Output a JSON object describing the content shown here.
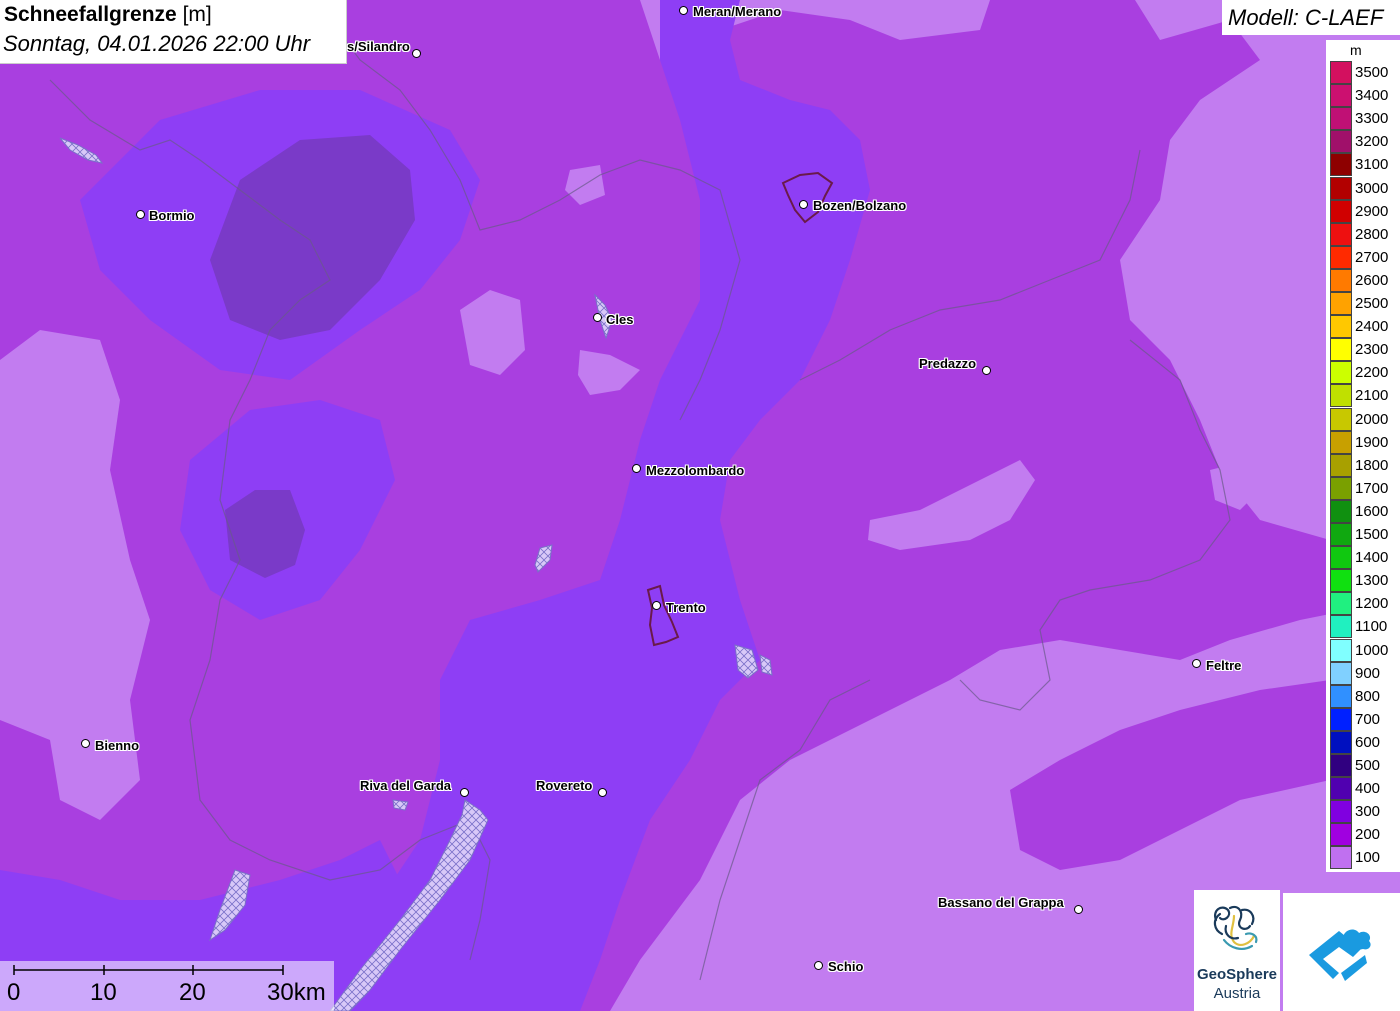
{
  "header": {
    "title": "Schneefallgrenze",
    "unit": "[m]",
    "datetime": "Sonntag, 04.01.2026 22:00 Uhr"
  },
  "model": {
    "label": "Modell: C-LAEF"
  },
  "legend": {
    "unit": "m",
    "items": [
      {
        "label": "3500",
        "color": "#d3105f"
      },
      {
        "label": "3400",
        "color": "#cc1070"
      },
      {
        "label": "3300",
        "color": "#c01075"
      },
      {
        "label": "3200",
        "color": "#a0106a"
      },
      {
        "label": "3100",
        "color": "#8e0000"
      },
      {
        "label": "3000",
        "color": "#b20000"
      },
      {
        "label": "2900",
        "color": "#d00000"
      },
      {
        "label": "2800",
        "color": "#ee1010"
      },
      {
        "label": "2700",
        "color": "#ff2a00"
      },
      {
        "label": "2600",
        "color": "#ff7a00"
      },
      {
        "label": "2500",
        "color": "#ffa200"
      },
      {
        "label": "2400",
        "color": "#ffc800"
      },
      {
        "label": "2300",
        "color": "#ffff00"
      },
      {
        "label": "2200",
        "color": "#ccff00"
      },
      {
        "label": "2100",
        "color": "#c0e000"
      },
      {
        "label": "2000",
        "color": "#c8c800"
      },
      {
        "label": "1900",
        "color": "#c8a000"
      },
      {
        "label": "1800",
        "color": "#a8a000"
      },
      {
        "label": "1700",
        "color": "#7aa000"
      },
      {
        "label": "1600",
        "color": "#109010"
      },
      {
        "label": "1500",
        "color": "#10a810"
      },
      {
        "label": "1400",
        "color": "#10c810"
      },
      {
        "label": "1300",
        "color": "#10e010"
      },
      {
        "label": "1200",
        "color": "#20f080"
      },
      {
        "label": "1100",
        "color": "#20f0c0"
      },
      {
        "label": "1000",
        "color": "#80ffff"
      },
      {
        "label": "900",
        "color": "#80d0ff"
      },
      {
        "label": "800",
        "color": "#3090ff"
      },
      {
        "label": "700",
        "color": "#0020ff"
      },
      {
        "label": "600",
        "color": "#0010c0"
      },
      {
        "label": "500",
        "color": "#300080"
      },
      {
        "label": "400",
        "color": "#5000b0"
      },
      {
        "label": "300",
        "color": "#8000e0"
      },
      {
        "label": "200",
        "color": "#a000e0"
      },
      {
        "label": "100",
        "color": "#c070f0"
      }
    ]
  },
  "places": [
    {
      "name": "Meran/Merano"
    },
    {
      "name": "s/Silandro"
    },
    {
      "name": "Bormio"
    },
    {
      "name": "Bozen/Bolzano"
    },
    {
      "name": "Cles"
    },
    {
      "name": "Predazzo"
    },
    {
      "name": "Mezzolombardo"
    },
    {
      "name": "Trento"
    },
    {
      "name": "Feltre"
    },
    {
      "name": "Bienno"
    },
    {
      "name": "Riva del Garda"
    },
    {
      "name": "Rovereto"
    },
    {
      "name": "Bassano del Grappa"
    },
    {
      "name": "Schio"
    }
  ],
  "scalebar": {
    "labels": [
      "0",
      "10",
      "20",
      "30km"
    ]
  },
  "logos": {
    "geosphere_line1": "GeoSphere",
    "geosphere_line2": "Austria"
  }
}
